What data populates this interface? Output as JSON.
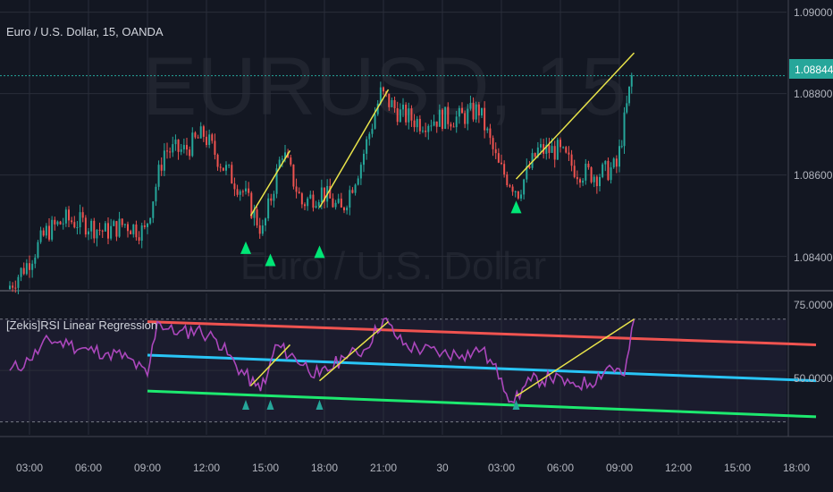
{
  "main_pane": {
    "title": "Euro / U.S. Dollar, 15, OANDA",
    "watermark_symbol": "EURUSD, 15",
    "watermark_name": "Euro / U.S. Dollar",
    "price_ticks": [
      "1.09000",
      "1.08800",
      "1.08600",
      "1.08400"
    ],
    "last_price": "1.08844"
  },
  "indicator_pane": {
    "title": "[Zekis]RSI Linear Regression",
    "ticks": [
      "75.00000",
      "50.00000"
    ]
  },
  "time_axis": {
    "labels": [
      "03:00",
      "06:00",
      "09:00",
      "12:00",
      "15:00",
      "18:00",
      "21:00",
      "30",
      "03:00",
      "06:00",
      "09:00",
      "12:00",
      "15:00",
      "18:00"
    ]
  },
  "colors": {
    "background": "#131722",
    "grid": "#2a2e39",
    "up_candle": "#26a69a",
    "down_candle": "#ef5350",
    "trend_line": "#e8e34a",
    "signal_marker": "#00e676",
    "last_price_line": "#26a69a",
    "rsi_line": "#ab47bc",
    "upper_band": "#f05350",
    "middle_band": "#29c5f6",
    "lower_band": "#1de96f"
  },
  "chart_data": {
    "type": "candlestick",
    "title": "Euro / U.S. Dollar, 15, OANDA",
    "x_ticks": [
      "03:00",
      "06:00",
      "09:00",
      "12:00",
      "15:00",
      "18:00",
      "21:00",
      "30",
      "03:00",
      "06:00",
      "09:00",
      "12:00",
      "15:00",
      "18:00"
    ],
    "price_ylim": [
      1.0832,
      1.0903
    ],
    "price_approx_path": [
      {
        "time": "02:00",
        "price": 1.0832
      },
      {
        "time": "03:00",
        "price": 1.0838
      },
      {
        "time": "04:00",
        "price": 1.0846
      },
      {
        "time": "05:00",
        "price": 1.0849
      },
      {
        "time": "06:00",
        "price": 1.0848
      },
      {
        "time": "07:00",
        "price": 1.0846
      },
      {
        "time": "08:00",
        "price": 1.0848
      },
      {
        "time": "09:00",
        "price": 1.0846
      },
      {
        "time": "10:00",
        "price": 1.0866
      },
      {
        "time": "11:00",
        "price": 1.0866
      },
      {
        "time": "12:00",
        "price": 1.087
      },
      {
        "time": "13:00",
        "price": 1.0862
      },
      {
        "time": "14:00",
        "price": 1.0856
      },
      {
        "time": "15:00",
        "price": 1.0846
      },
      {
        "time": "16:00",
        "price": 1.0866
      },
      {
        "time": "17:00",
        "price": 1.0853
      },
      {
        "time": "18:00",
        "price": 1.0856
      },
      {
        "time": "19:00",
        "price": 1.0851
      },
      {
        "time": "20:00",
        "price": 1.0863
      },
      {
        "time": "21:00",
        "price": 1.088
      },
      {
        "time": "22:00",
        "price": 1.0875
      },
      {
        "time": "23:00",
        "price": 1.0873
      },
      {
        "time": "00:00",
        "price": 1.0874
      },
      {
        "time": "01:00",
        "price": 1.0874
      },
      {
        "time": "02:00",
        "price": 1.0876
      },
      {
        "time": "03:00",
        "price": 1.0862
      },
      {
        "time": "04:00",
        "price": 1.0856
      },
      {
        "time": "05:00",
        "price": 1.0866
      },
      {
        "time": "06:00",
        "price": 1.0866
      },
      {
        "time": "07:00",
        "price": 1.0861
      },
      {
        "time": "08:00",
        "price": 1.086
      },
      {
        "time": "09:00",
        "price": 1.0862
      },
      {
        "time": "09:45",
        "price": 1.0884
      }
    ],
    "trend_lines": [
      {
        "from": {
          "time": "14:15",
          "price": 1.085
        },
        "to": {
          "time": "16:15",
          "price": 1.0866
        }
      },
      {
        "from": {
          "time": "17:45",
          "price": 1.0852
        },
        "to": {
          "time": "21:15",
          "price": 1.0881
        }
      },
      {
        "from": {
          "time": "03:45",
          "price": 1.0859
        },
        "to": {
          "time": "09:45",
          "price": 1.089
        }
      }
    ],
    "signals": [
      {
        "time": "14:00",
        "price": 1.0845
      },
      {
        "time": "15:15",
        "price": 1.0842
      },
      {
        "time": "17:45",
        "price": 1.0844
      },
      {
        "time": "03:45",
        "price": 1.0855
      }
    ],
    "last_price": 1.08844,
    "indicator": {
      "name": "[Zekis]RSI Linear Regression",
      "ylim": [
        25,
        80
      ],
      "levels": [
        70,
        30
      ],
      "rsi": [
        {
          "time": "02:00",
          "value": 50
        },
        {
          "time": "03:00",
          "value": 54
        },
        {
          "time": "04:00",
          "value": 62
        },
        {
          "time": "05:00",
          "value": 60
        },
        {
          "time": "06:00",
          "value": 58
        },
        {
          "time": "07:00",
          "value": 57
        },
        {
          "time": "08:00",
          "value": 55
        },
        {
          "time": "09:00",
          "value": 48
        },
        {
          "time": "09:30",
          "value": 69
        },
        {
          "time": "10:30",
          "value": 64
        },
        {
          "time": "11:30",
          "value": 66
        },
        {
          "time": "12:30",
          "value": 62
        },
        {
          "time": "13:30",
          "value": 52
        },
        {
          "time": "14:30",
          "value": 44
        },
        {
          "time": "15:00",
          "value": 45
        },
        {
          "time": "15:30",
          "value": 60
        },
        {
          "time": "16:30",
          "value": 55
        },
        {
          "time": "17:45",
          "value": 48
        },
        {
          "time": "19:00",
          "value": 55
        },
        {
          "time": "20:00",
          "value": 58
        },
        {
          "time": "21:00",
          "value": 70
        },
        {
          "time": "22:00",
          "value": 60
        },
        {
          "time": "23:00",
          "value": 58
        },
        {
          "time": "00:00",
          "value": 57
        },
        {
          "time": "01:00",
          "value": 56
        },
        {
          "time": "02:00",
          "value": 58
        },
        {
          "time": "03:00",
          "value": 47
        },
        {
          "time": "03:30",
          "value": 38
        },
        {
          "time": "04:30",
          "value": 46
        },
        {
          "time": "05:30",
          "value": 47
        },
        {
          "time": "06:30",
          "value": 45
        },
        {
          "time": "07:30",
          "value": 45
        },
        {
          "time": "08:30",
          "value": 52
        },
        {
          "time": "09:15",
          "value": 48
        },
        {
          "time": "09:45",
          "value": 70
        }
      ],
      "upper_band": [
        {
          "time": "09:00",
          "value": 69
        },
        {
          "time": "19:00",
          "value": 60
        }
      ],
      "middle_band": [
        {
          "time": "09:00",
          "value": 56
        },
        {
          "time": "19:00",
          "value": 46
        }
      ],
      "lower_band": [
        {
          "time": "09:00",
          "value": 42
        },
        {
          "time": "19:00",
          "value": 32
        }
      ],
      "trend_lines": [
        {
          "from": {
            "time": "14:15",
            "value": 44
          },
          "to": {
            "time": "16:15",
            "value": 60
          }
        },
        {
          "from": {
            "time": "17:45",
            "value": 46
          },
          "to": {
            "time": "21:15",
            "value": 69
          }
        },
        {
          "from": {
            "time": "03:45",
            "value": 40
          },
          "to": {
            "time": "09:45",
            "value": 70
          }
        }
      ],
      "signals": [
        "14:00",
        "15:15",
        "17:45",
        "03:45"
      ]
    }
  }
}
